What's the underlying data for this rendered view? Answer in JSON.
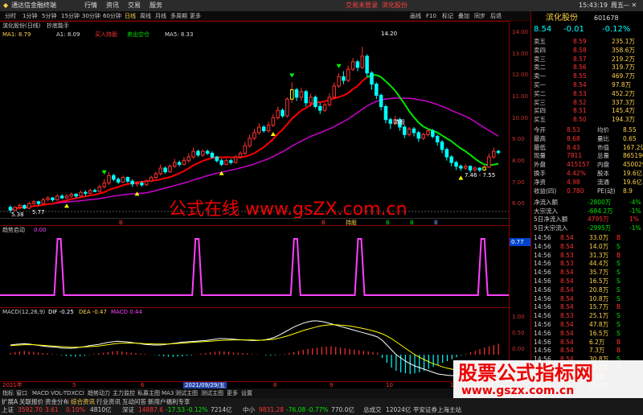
{
  "app": {
    "broker": "通达信金融终端",
    "menus": [
      "行情",
      "资讯",
      "交易",
      "服务"
    ],
    "promo1": "交易未登录",
    "promo2": "滨化股份",
    "time": "15:43:19",
    "week": "周五"
  },
  "toolbar": {
    "periods": [
      "分时",
      "1分钟",
      "5分钟",
      "15分钟",
      "30分钟",
      "60分钟",
      "日线",
      "周线",
      "月线",
      "多周期",
      "更多"
    ],
    "active_period": "日线",
    "right": [
      "画线",
      "F10",
      "标记",
      "叠加",
      "同步",
      "后退"
    ]
  },
  "main_legend": {
    "name": "滨化股份(日线)",
    "formula": "抄底能手",
    "ma1": "MA1: 8.79",
    "a1": "A1: 8.09",
    "buy_txt": "买入持股",
    "sell_txt": "卖出空仓",
    "ma5": "MA5: 8.33"
  },
  "watermark": "公式在线  www.gsZX.com.cn",
  "brand": "股票公式指标网",
  "brand_url": "www.gszx.com.cn",
  "annotations": {
    "high": "14.20",
    "low": "5.38",
    "low2": "5.77",
    "right_low": "7.46 - 7.55",
    "buy": "买",
    "sell": "卖",
    "hold": "持股",
    "markers": [
      "B",
      "B",
      "持股",
      "B",
      "B",
      "B",
      "B"
    ]
  },
  "ind1": {
    "name": "趋势启动",
    "value": "0.00",
    "tick": "0.77"
  },
  "ind2": {
    "name": "MACD(12,26,9)",
    "dif": "DIF -0.25",
    "dea": "DEA -0.47",
    "macd": "MACD 0.44"
  },
  "date_axis": {
    "left": "2021年",
    "mid": "2021/09/29/五",
    "ticks": [
      "5",
      "6",
      "7",
      "8",
      "9",
      "10",
      "11"
    ]
  },
  "y_axis": [
    "14.00",
    "13.00",
    "12.00",
    "11.00",
    "10.00",
    "9.00",
    "8.00",
    "7.00",
    "6.00"
  ],
  "y_axis_macd": [
    "1.00",
    "0.50",
    "0.00"
  ],
  "bottom_tabs": [
    "指标",
    "窗口",
    "MACD",
    "VOL-TDX",
    "CCI",
    "趋势动力",
    "主力监控",
    "私募主图",
    "MA3",
    "测试主图",
    "测试主图",
    "更多",
    "设置"
  ],
  "bottom_tabs2": [
    "扩展A",
    "关联报价",
    "资金分布",
    "综合资讯",
    "行业资讯",
    "互动问答",
    "新用户福利专享"
  ],
  "quote": {
    "code": "601678",
    "name": "滨化股份",
    "price": "8.54",
    "change": "-0.01",
    "pct": "-0.12%"
  },
  "orderbook": [
    {
      "label": "卖五",
      "price": "8.59",
      "vol": "235.1万"
    },
    {
      "label": "卖四",
      "price": "8.58",
      "vol": "358.6万"
    },
    {
      "label": "卖三",
      "price": "8.57",
      "vol": "219.2万"
    },
    {
      "label": "卖二",
      "price": "8.56",
      "vol": "319.7万"
    },
    {
      "label": "卖一",
      "price": "8.55",
      "vol": "469.7万"
    },
    {
      "label": "买一",
      "price": "8.54",
      "vol": "97.8万"
    },
    {
      "label": "买二",
      "price": "8.53",
      "vol": "452.2万"
    },
    {
      "label": "买三",
      "price": "8.52",
      "vol": "337.3万"
    },
    {
      "label": "买四",
      "price": "8.51",
      "vol": "145.4万"
    },
    {
      "label": "买五",
      "price": "8.50",
      "vol": "194.3万"
    }
  ],
  "stats": [
    [
      "今开",
      "8.53",
      "均价",
      "8.55"
    ],
    [
      "最高",
      "8.68",
      "量比",
      "0.65"
    ],
    [
      "最低",
      "8.43",
      "市值",
      "167.2亿"
    ],
    [
      "现量",
      "7811",
      "总量",
      "865196"
    ],
    [
      "外盘",
      "415157",
      "内盘",
      "450029"
    ],
    [
      "换手",
      "4.42%",
      "股本",
      "19.6亿"
    ],
    [
      "净资",
      "4.98",
      "流通",
      "19.6亿"
    ],
    [
      "收益(四)",
      "0.780",
      "PE(动)",
      "8.9"
    ]
  ],
  "flows": [
    {
      "label": "净流入额",
      "val": "-2800万",
      "pct": "-4%"
    },
    {
      "label": "大宗流入",
      "val": "-684.2万",
      "pct": "-1%"
    },
    {
      "label": "5日净流入额",
      "val": "4795万",
      "pct": "1%"
    },
    {
      "label": "5日大宗流入",
      "val": "-2995万",
      "pct": "-1%"
    }
  ],
  "ticks": [
    [
      "14:56",
      "8.54",
      "33.0万",
      "B"
    ],
    [
      "14:56",
      "8.54",
      "14.0万",
      "S"
    ],
    [
      "14:56",
      "8.53",
      "31.3万",
      "B"
    ],
    [
      "14:56",
      "8.53",
      "44.4万",
      "S"
    ],
    [
      "14:56",
      "8.54",
      "35.7万",
      "S"
    ],
    [
      "14:56",
      "8.54",
      "16.5万",
      "S"
    ],
    [
      "14:56",
      "8.54",
      "20.8万",
      "S"
    ],
    [
      "14:56",
      "8.54",
      "10.8万",
      "S"
    ],
    [
      "14:56",
      "8.54",
      "15.7万",
      "B"
    ],
    [
      "14:56",
      "8.53",
      "25.1万",
      "S"
    ],
    [
      "14:56",
      "8.54",
      "47.8万",
      "S"
    ],
    [
      "14:56",
      "8.54",
      "16.5万",
      "S"
    ],
    [
      "14:56",
      "8.54",
      "6.2万",
      "B"
    ],
    [
      "14:56",
      "8.54",
      "7.3万",
      "B"
    ],
    [
      "14:56",
      "8.54",
      "30.8万",
      "S"
    ],
    [
      "14:56",
      "8.54",
      "12.2万",
      "S"
    ],
    [
      "14:56",
      "8.54",
      "7.2万",
      "B"
    ],
    [
      "14:56",
      "8.55",
      "30.0万",
      "B"
    ]
  ],
  "status": {
    "items": [
      {
        "name": "上证",
        "val": "3592.70",
        "chg": "3.61",
        "pct": "0.10%",
        "amt": "4810亿"
      },
      {
        "name": "深证",
        "val": "14887.6",
        "chg": "-17.53",
        "pct": "-0.12%",
        "amt": "7214亿"
      },
      {
        "name": "中小",
        "val": "9831.28",
        "chg": "-76.08",
        "pct": "-0.77%",
        "amt": "770.0亿"
      }
    ],
    "extra": "总成交",
    "total": "12024亿",
    "tail": "平安证券上海主站"
  },
  "colors": {
    "up": "#ff3232",
    "down": "#00ffff",
    "ma_red": "#ff0000",
    "ma_green": "#00e600",
    "ma_purple": "#cc00cc",
    "yellow": "#ffff00"
  },
  "chart_data": {
    "type": "candlestick",
    "title": "滨化股份(日线)",
    "x_range": [
      "2021-05",
      "2021-11"
    ],
    "candles": [
      [
        5.6,
        5.45,
        5.7,
        5.3
      ],
      [
        5.45,
        5.6,
        5.65,
        5.38
      ],
      [
        5.6,
        5.7,
        5.8,
        5.5
      ],
      [
        5.7,
        5.55,
        5.75,
        5.5
      ],
      [
        5.55,
        5.8,
        5.9,
        5.5
      ],
      [
        5.8,
        5.9,
        6.0,
        5.7
      ],
      [
        5.9,
        5.8,
        5.95,
        5.7
      ],
      [
        5.8,
        6.0,
        6.1,
        5.75
      ],
      [
        6.0,
        6.1,
        6.2,
        5.95
      ],
      [
        6.1,
        6.0,
        6.15,
        5.9
      ],
      [
        6.0,
        6.2,
        6.3,
        5.95
      ],
      [
        6.2,
        6.1,
        6.3,
        6.05
      ],
      [
        6.1,
        6.2,
        6.3,
        6.05
      ],
      [
        6.2,
        6.3,
        6.4,
        6.1
      ],
      [
        6.3,
        6.2,
        6.35,
        6.1
      ],
      [
        6.2,
        6.4,
        6.5,
        6.15
      ],
      [
        6.4,
        6.35,
        6.5,
        6.2
      ],
      [
        6.35,
        6.5,
        6.6,
        6.3
      ],
      [
        6.5,
        6.45,
        6.6,
        6.4
      ],
      [
        6.45,
        6.7,
        6.8,
        6.4
      ],
      [
        6.7,
        6.9,
        7.1,
        6.6
      ],
      [
        6.9,
        7.3,
        7.5,
        6.8
      ],
      [
        7.3,
        7.1,
        7.4,
        7.0
      ],
      [
        7.1,
        6.95,
        7.2,
        6.85
      ],
      [
        6.95,
        7.2,
        7.3,
        6.9
      ],
      [
        7.2,
        7.0,
        7.25,
        6.9
      ],
      [
        7.0,
        6.85,
        7.1,
        6.7
      ],
      [
        6.85,
        6.9,
        7.0,
        6.7
      ],
      [
        6.9,
        6.8,
        7.0,
        6.7
      ],
      [
        6.8,
        7.0,
        7.1,
        6.75
      ],
      [
        7.0,
        7.2,
        7.3,
        6.95
      ],
      [
        7.2,
        7.4,
        7.5,
        7.1
      ],
      [
        7.4,
        7.7,
        7.9,
        7.3
      ],
      [
        7.7,
        7.5,
        7.8,
        7.4
      ],
      [
        7.5,
        7.8,
        7.9,
        7.45
      ],
      [
        7.8,
        8.0,
        8.2,
        7.7
      ],
      [
        8.0,
        7.9,
        8.1,
        7.8
      ],
      [
        7.9,
        8.1,
        8.3,
        7.85
      ],
      [
        8.1,
        8.3,
        8.5,
        8.0
      ],
      [
        8.3,
        8.6,
        8.8,
        8.2
      ],
      [
        8.6,
        8.4,
        8.7,
        8.3
      ],
      [
        8.4,
        8.6,
        8.7,
        8.3
      ],
      [
        8.6,
        8.5,
        8.7,
        8.4
      ],
      [
        8.5,
        8.3,
        8.6,
        8.2
      ],
      [
        8.3,
        8.1,
        8.35,
        8.0
      ],
      [
        8.1,
        7.9,
        8.2,
        7.8
      ],
      [
        7.9,
        8.1,
        8.2,
        7.85
      ],
      [
        8.1,
        8.0,
        8.2,
        7.9
      ],
      [
        8.0,
        8.3,
        8.4,
        7.95
      ],
      [
        8.3,
        8.5,
        8.6,
        8.2
      ],
      [
        8.5,
        8.9,
        9.1,
        8.4
      ],
      [
        8.9,
        9.3,
        9.5,
        8.8
      ],
      [
        9.3,
        9.6,
        9.8,
        9.2
      ],
      [
        9.6,
        9.9,
        10.1,
        9.5
      ],
      [
        9.9,
        9.7,
        10.0,
        9.6
      ],
      [
        9.7,
        10.0,
        10.2,
        9.6
      ],
      [
        10.0,
        10.4,
        10.6,
        9.9
      ],
      [
        10.4,
        10.8,
        11.0,
        10.3
      ],
      [
        10.8,
        10.5,
        10.9,
        10.4
      ],
      [
        10.5,
        11.4,
        11.5,
        10.4
      ],
      [
        11.4,
        11.9,
        12.3,
        11.2
      ],
      [
        11.9,
        11.5,
        12.0,
        11.3
      ],
      [
        11.5,
        11.8,
        12.0,
        11.3
      ],
      [
        11.8,
        11.2,
        11.9,
        11.0
      ],
      [
        11.2,
        11.5,
        11.7,
        11.0
      ],
      [
        11.5,
        11.0,
        11.6,
        10.9
      ],
      [
        11.0,
        10.8,
        11.2,
        10.6
      ],
      [
        10.8,
        11.1,
        11.2,
        10.7
      ],
      [
        11.1,
        11.5,
        11.7,
        11.0
      ],
      [
        11.5,
        12.1,
        12.3,
        11.4
      ],
      [
        12.1,
        12.6,
        12.8,
        12.0
      ],
      [
        12.6,
        12.4,
        12.9,
        12.2
      ],
      [
        12.4,
        13.0,
        13.2,
        12.3
      ],
      [
        13.0,
        13.4,
        13.6,
        12.9
      ],
      [
        13.4,
        13.1,
        13.5,
        12.9
      ],
      [
        13.1,
        13.7,
        14.2,
        13.0
      ],
      [
        13.7,
        12.8,
        13.8,
        12.6
      ],
      [
        12.8,
        12.2,
        12.9,
        11.9
      ],
      [
        12.2,
        11.6,
        12.3,
        11.4
      ],
      [
        11.6,
        11.0,
        11.7,
        10.8
      ],
      [
        11.0,
        10.3,
        11.1,
        10.1
      ],
      [
        10.3,
        10.1,
        10.4,
        9.8
      ],
      [
        10.1,
        10.3,
        10.5,
        10.0
      ],
      [
        10.3,
        9.9,
        10.4,
        9.7
      ],
      [
        9.9,
        9.5,
        10.0,
        9.3
      ],
      [
        9.5,
        9.8,
        9.9,
        9.4
      ],
      [
        9.8,
        9.6,
        9.9,
        9.4
      ],
      [
        9.6,
        9.3,
        9.7,
        9.1
      ],
      [
        9.3,
        9.5,
        9.6,
        9.2
      ],
      [
        9.5,
        9.7,
        9.8,
        9.4
      ],
      [
        9.7,
        9.4,
        9.8,
        9.3
      ],
      [
        9.4,
        9.1,
        9.5,
        8.9
      ],
      [
        9.1,
        8.7,
        9.2,
        8.5
      ],
      [
        8.7,
        8.3,
        8.8,
        8.1
      ],
      [
        8.3,
        8.0,
        8.4,
        7.8
      ],
      [
        8.0,
        7.8,
        8.1,
        7.6
      ],
      [
        7.8,
        7.7,
        7.9,
        7.55
      ],
      [
        7.7,
        7.8,
        7.9,
        7.6
      ],
      [
        7.8,
        7.6,
        7.85,
        7.46
      ],
      [
        7.6,
        7.7,
        7.8,
        7.5
      ],
      [
        7.7,
        7.6,
        7.75,
        7.5
      ],
      [
        7.6,
        7.75,
        7.85,
        7.55
      ],
      [
        7.75,
        8.3,
        8.5,
        7.7
      ],
      [
        8.3,
        8.6,
        8.8,
        8.2
      ],
      [
        8.6,
        8.54,
        8.68,
        8.43
      ]
    ],
    "pulses": [
      0.12,
      0.4,
      0.6,
      0.73,
      0.98
    ],
    "macd_hist": [
      0.05,
      0.08,
      0.1,
      0.12,
      0.1,
      0.09,
      0.07,
      0.05,
      0.04,
      0.02,
      0.01,
      -0.02,
      -0.04,
      -0.05,
      -0.06,
      -0.05,
      -0.03,
      -0.01,
      0.02,
      0.04,
      0.06,
      0.08,
      0.1,
      0.12,
      0.1,
      0.08,
      0.06,
      0.05,
      0.03,
      0.02,
      0.01,
      -0.01,
      -0.03,
      -0.05,
      -0.06,
      -0.07,
      -0.06,
      -0.05,
      -0.03,
      -0.02,
      0.01,
      0.03,
      0.05,
      0.07,
      0.09,
      0.11,
      0.1,
      0.09,
      0.07,
      0.06,
      0.05,
      0.04,
      0.02,
      0.01,
      0.0,
      -0.02,
      -0.03,
      -0.02,
      -0.01,
      0.02,
      0.05,
      0.08,
      0.12,
      0.15,
      0.18,
      0.2,
      0.22,
      0.24,
      0.25,
      0.26,
      0.24,
      0.22,
      0.2,
      0.18,
      0.16,
      0.14,
      0.12,
      0.1,
      0.08,
      0.06,
      -0.1,
      -0.25,
      -0.4,
      -0.5,
      -0.55,
      -0.58,
      -0.6,
      -0.58,
      -0.55,
      -0.5,
      -0.44,
      -0.38,
      -0.32,
      -0.25,
      -0.2,
      -0.14,
      -0.08,
      -0.02,
      0.02,
      0.08,
      0.12,
      0.18,
      0.22,
      0.26,
      0.3,
      0.34
    ],
    "dif": [
      0.3,
      0.32,
      0.33,
      0.34,
      0.33,
      0.31,
      0.29,
      0.27,
      0.25,
      0.24,
      0.23,
      0.21,
      0.2,
      0.2,
      0.21,
      0.23,
      0.25,
      0.28,
      0.3,
      0.32,
      0.35,
      0.38,
      0.4,
      0.42,
      0.41,
      0.4,
      0.38,
      0.36,
      0.34,
      0.32,
      0.31,
      0.3,
      0.3,
      0.31,
      0.33,
      0.35,
      0.37,
      0.39,
      0.4,
      0.41,
      0.42,
      0.43,
      0.44,
      0.46,
      0.48,
      0.5,
      0.5,
      0.49,
      0.48,
      0.47,
      0.46,
      0.45,
      0.44,
      0.44,
      0.45,
      0.47,
      0.5,
      0.55,
      0.62,
      0.7,
      0.78,
      0.86,
      0.92,
      0.98,
      1.02,
      1.05,
      1.05,
      1.03,
      1.0,
      0.96,
      0.92,
      0.88,
      0.84,
      0.8,
      0.76,
      0.72,
      0.68,
      0.64,
      0.6,
      0.55,
      0.45,
      0.3,
      0.15,
      0.0,
      -0.1,
      -0.2,
      -0.28,
      -0.35,
      -0.4,
      -0.45,
      -0.5,
      -0.55,
      -0.6,
      -0.62,
      -0.64,
      -0.65,
      -0.64,
      -0.62,
      -0.6,
      -0.56,
      -0.5,
      -0.44,
      -0.38,
      -0.32,
      -0.28,
      -0.25
    ],
    "dea": [
      0.28,
      0.29,
      0.3,
      0.31,
      0.31,
      0.31,
      0.3,
      0.29,
      0.28,
      0.27,
      0.26,
      0.25,
      0.24,
      0.23,
      0.23,
      0.23,
      0.24,
      0.25,
      0.26,
      0.27,
      0.29,
      0.31,
      0.33,
      0.35,
      0.36,
      0.36,
      0.36,
      0.36,
      0.35,
      0.34,
      0.34,
      0.33,
      0.33,
      0.33,
      0.33,
      0.34,
      0.35,
      0.36,
      0.37,
      0.38,
      0.39,
      0.4,
      0.41,
      0.42,
      0.43,
      0.44,
      0.45,
      0.45,
      0.46,
      0.46,
      0.46,
      0.46,
      0.46,
      0.45,
      0.45,
      0.46,
      0.47,
      0.49,
      0.52,
      0.56,
      0.6,
      0.65,
      0.7,
      0.75,
      0.79,
      0.83,
      0.87,
      0.9,
      0.92,
      0.93,
      0.93,
      0.92,
      0.91,
      0.89,
      0.87,
      0.84,
      0.81,
      0.78,
      0.74,
      0.7,
      0.65,
      0.58,
      0.5,
      0.4,
      0.3,
      0.2,
      0.1,
      0.0,
      -0.08,
      -0.15,
      -0.22,
      -0.28,
      -0.33,
      -0.38,
      -0.42,
      -0.45,
      -0.48,
      -0.5,
      -0.51,
      -0.51,
      -0.5,
      -0.49,
      -0.48,
      -0.47,
      -0.47,
      -0.47
    ]
  }
}
